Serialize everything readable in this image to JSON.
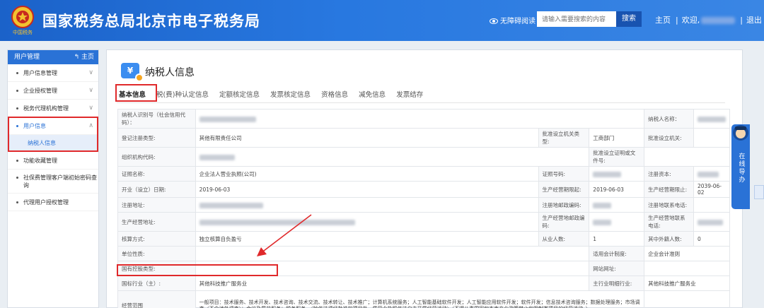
{
  "header": {
    "title": "国家税务总局北京市电子税务局",
    "emblem_text": "中国税务",
    "accessibility_label": "无障碍阅读",
    "search_placeholder": "请输入需要搜索的内容",
    "search_button": "搜索",
    "home_link": "主页",
    "welcome_prefix": "欢迎,",
    "logout_link": "退出"
  },
  "sidebar": {
    "header": "用户管理",
    "home": "主页",
    "items": [
      {
        "label": "用户信息管理"
      },
      {
        "label": "企业授权管理"
      },
      {
        "label": "税务代理机构管理"
      },
      {
        "label": "用户信息"
      },
      {
        "label": "功能收藏管理"
      },
      {
        "label": "社保费管理客户端初始密码查询"
      },
      {
        "label": "代理用户授权管理"
      }
    ],
    "sub_item": "纳税人信息"
  },
  "main": {
    "title": "纳税人信息",
    "icon_glyph": "¥",
    "tabs": [
      "基本信息",
      "税(费)种认定信息",
      "定额核定信息",
      "发票核定信息",
      "资格信息",
      "减免信息",
      "发票结存"
    ]
  },
  "table": {
    "r1": {
      "l1": "纳税人识别号（社会信用代码）：",
      "l2": "纳税人名称："
    },
    "r2": {
      "l1": "登记注册类型:",
      "v1": "其他有限责任公司",
      "l2": "批准设立机关类型:",
      "v2": "工商部门",
      "l3": "批准设立机关:"
    },
    "r3": {
      "l1": "组织机构代码:",
      "l2": "批准设立证明或文件号:"
    },
    "r4": {
      "l1": "证照名称:",
      "v1": "企业法人营业执照(公司)",
      "l2": "证照号码:",
      "l3": "注册资本:"
    },
    "r5": {
      "l1": "开业（设立）日期:",
      "v1": "2019-06-03",
      "l2": "生产经营期限起:",
      "v2": "2019-06-03",
      "l3": "生产经营期限止:",
      "v3": "2039-06-02"
    },
    "r6": {
      "l1": "注册地址:",
      "l2": "注册地邮政编码:",
      "l3": "注册地联系电话:"
    },
    "r7": {
      "l1": "生产经营地址:",
      "l2": "生产经营地邮政编码:",
      "l3": "生产经营地联系电话:"
    },
    "r8": {
      "l1": "核算方式:",
      "v1": "独立核算自负盈亏",
      "l2": "从业人数:",
      "v2": "1",
      "l3": "其中外籍人数:",
      "v3": "0"
    },
    "r9": {
      "l1": "单位性质:",
      "l2": "适用会计制度:",
      "v2": "企业会计准则"
    },
    "r10": {
      "l1": "国有控股类型:",
      "l2": "网站网址:"
    },
    "r11": {
      "l1": "国标行业（主）:",
      "v1": "其他科技推广服务业",
      "l2": "主行业明细行业:",
      "v2": "其他科技推广服务业"
    },
    "r12": {
      "l1": "经营范围",
      "v1": "一般项目：技术服务、技术开发、技术咨询、技术交流、技术转让、技术推广；计算机系统服务；人工智能基础软件开发；人工智能应用软件开发；软件开发；信息技术咨询服务；数据处理服务；市场调查（不含涉外调查）；会议及展览服务；税务服务。（除依法须经批准的项目外，凭营业执照依法自主开展经营活动）（不得从事国家和本市产业政策禁止和限制类项目的经营活动。）"
    }
  },
  "float": {
    "online_service": "在线导办"
  },
  "colors": {
    "header_blue": "#2070d8",
    "highlight_red": "#e0292b",
    "accent_blue": "#2a72d6"
  }
}
